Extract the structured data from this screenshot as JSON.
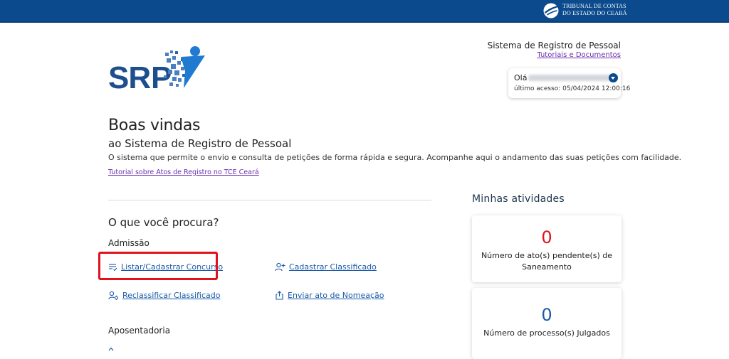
{
  "header": {
    "org_line1": "TRIBUNAL DE CONTAS",
    "org_line2": "DO ESTADO DO CEARÁ",
    "brand_color": "#0b4a8c"
  },
  "logo": {
    "text": "SRP",
    "icon": "srp-logo-icon"
  },
  "system": {
    "title": "Sistema de Registro de Pessoal",
    "link": "Tutoriais e Documentos"
  },
  "user": {
    "greeting": "Olá",
    "last_access": "último acesso: 05/04/2024 12:00:16"
  },
  "welcome": {
    "title": "Boas vindas",
    "subtitle": "ao Sistema de Registro de Pessoal",
    "description": "O sistema que permite o envio e consulta de petições de forma rápida e segura. Acompanhe aqui o andamento das suas petições com facilidade.",
    "tutorial_link": "Tutorial sobre Atos de Registro no TCE Ceará"
  },
  "search": {
    "heading": "O que você procura?",
    "sections": {
      "admissao": "Admissão",
      "aposentadoria": "Aposentadoria"
    },
    "actions": [
      {
        "label": "Listar/Cadastrar Concurso",
        "icon": "list-check-icon"
      },
      {
        "label": "Cadastrar Classificado",
        "icon": "user-add-icon"
      },
      {
        "label": "Reclassificar Classificado",
        "icon": "user-settings-icon"
      },
      {
        "label": "Enviar ato de Nomeação",
        "icon": "upload-icon"
      }
    ]
  },
  "activities": {
    "heading": "Minhas atividades",
    "cards": [
      {
        "value": "0",
        "label": "Número de ato(s) pendente(s) de Saneamento",
        "color": "#e0121a"
      },
      {
        "value": "0",
        "label": "Número de processo(s) Julgados",
        "color": "#1a5aa8"
      }
    ]
  },
  "highlight_color": "#e0121a"
}
